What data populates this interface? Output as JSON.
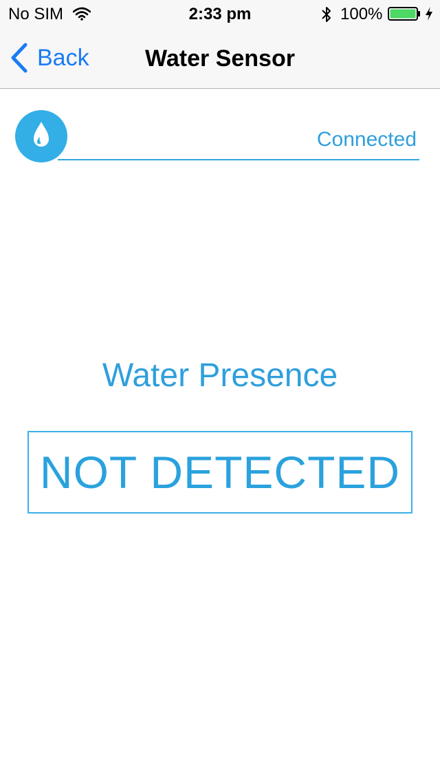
{
  "status_bar": {
    "carrier": "No SIM",
    "time": "2:33 pm",
    "battery_percent": "100%",
    "battery_level": 1.0,
    "icons": [
      "wifi-icon",
      "bluetooth-icon",
      "battery-icon",
      "charging-bolt-icon"
    ]
  },
  "nav": {
    "back_label": "Back",
    "title": "Water Sensor"
  },
  "device": {
    "icon": "water-drop-icon",
    "status": "Connected"
  },
  "main": {
    "label": "Water Presence",
    "value": "NOT DETECTED"
  },
  "colors": {
    "accent_blue": "#1a7cf4",
    "sensor_blue": "#2f9fdc",
    "icon_blue": "#33aee6",
    "battery_green": "#4cd964",
    "nav_background": "#f7f7f7"
  }
}
